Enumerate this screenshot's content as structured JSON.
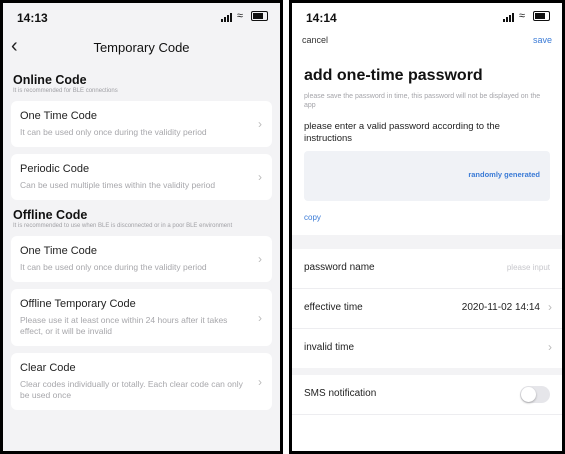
{
  "left": {
    "status_time": "14:13",
    "title": "Temporary Code",
    "online": {
      "heading": "Online Code",
      "hint": "It is recommended for BLE connections",
      "cards": [
        {
          "title": "One Time Code",
          "desc": "It can be used only once during the validity period"
        },
        {
          "title": "Periodic Code",
          "desc": "Can be used multiple times within the validity period"
        }
      ]
    },
    "offline": {
      "heading": "Offline Code",
      "hint": "It is recommended to use when BLE is disconnected or in a poor BLE environment",
      "cards": [
        {
          "title": "One Time Code",
          "desc": "It can be used only once during the validity period"
        },
        {
          "title": "Offline Temporary Code",
          "desc": "Please use it at least once within 24 hours after it takes effect, or it will be invalid"
        },
        {
          "title": "Clear Code",
          "desc": "Clear codes individually or totally. Each clear code can only be used once"
        }
      ]
    }
  },
  "right": {
    "status_time": "14:14",
    "cancel": "cancel",
    "save": "save",
    "title": "add one-time password",
    "note": "please save the password in time, this password will not be displayed on the app",
    "instruction": "please enter a valid password according to the instructions",
    "generate": "randomly generated",
    "copy": "copy",
    "rows": {
      "name_label": "password name",
      "name_placeholder": "please input",
      "effective_label": "effective time",
      "effective_value": "2020-11-02 14:14",
      "invalid_label": "invalid time",
      "sms_label": "SMS notification",
      "sms_on": false
    }
  },
  "colors": {
    "accent": "#3b7bd6",
    "background": "#f3f3f5"
  }
}
